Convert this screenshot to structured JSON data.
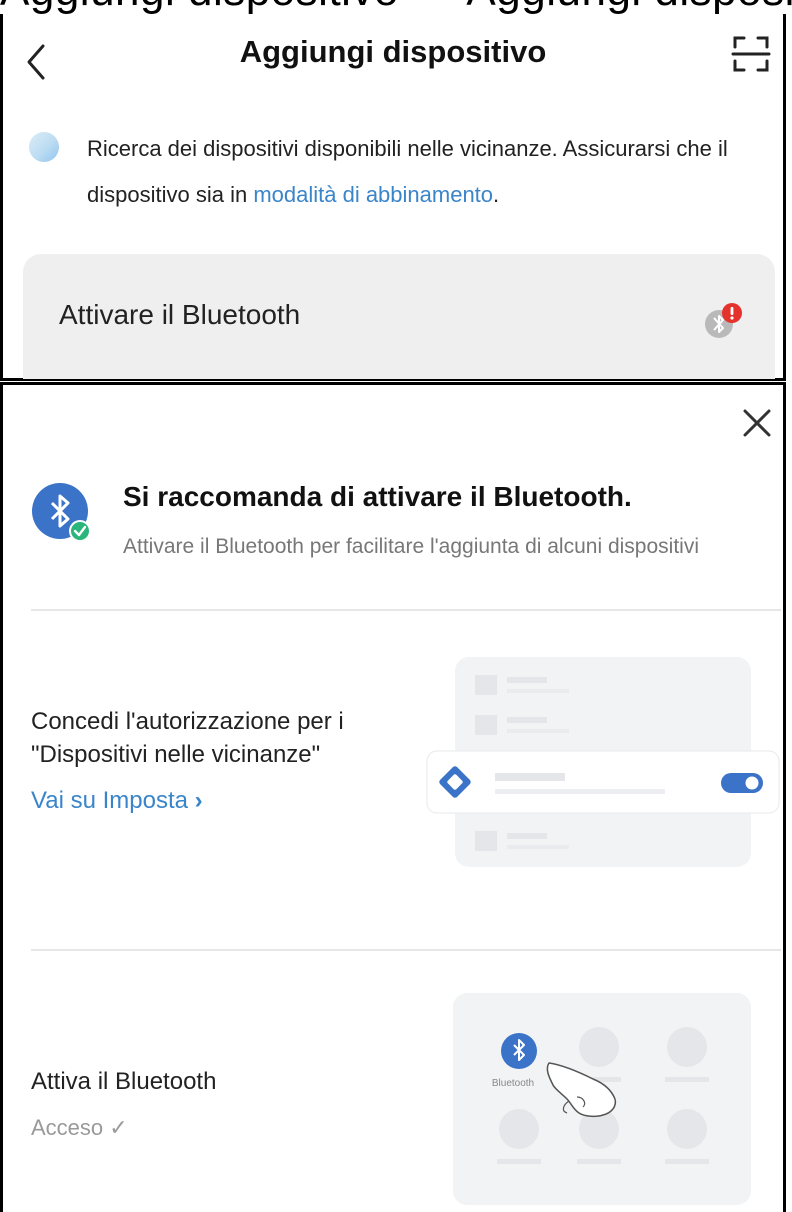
{
  "caption": "Aggiungi dispositivo — Aggiungi dispositivo app",
  "header": {
    "title": "Aggiungi dispositivo"
  },
  "search": {
    "text_part1": "Ricerca dei dispositivi disponibili nelle vicinanze. Assicurarsi che il dispositivo sia in ",
    "link": "modalità di abbinamento",
    "text_part2": "."
  },
  "bluetooth_card": {
    "label": "Attivare il Bluetooth"
  },
  "sheet": {
    "title": "Si raccomanda di attivare il Bluetooth.",
    "subtitle": "Attivare il Bluetooth per facilitare l'aggiunta di alcuni dispositivi",
    "permission": {
      "title": "Concedi l'autorizzazione per i \"Dispositivi nelle vicinanze\"",
      "link": "Vai su Imposta"
    },
    "bluetooth": {
      "title": "Attiva il Bluetooth",
      "status": "Acceso ✓",
      "illustration_label": "Bluetooth"
    }
  },
  "colors": {
    "accent": "#3a85c9",
    "bt_blue": "#3b73c8",
    "check_green": "#2ab57a",
    "warn_red": "#e5322d"
  }
}
